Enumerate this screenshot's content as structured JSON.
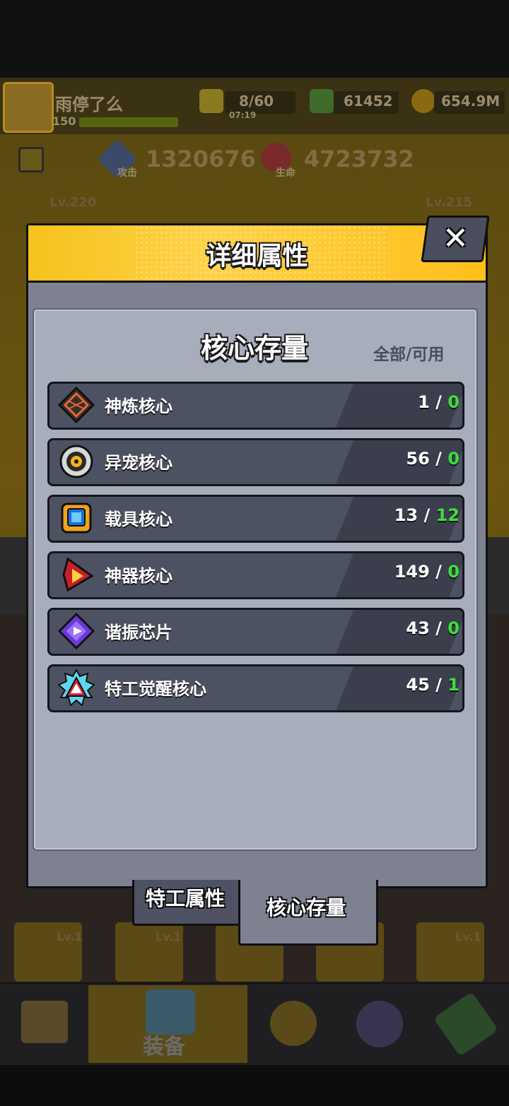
{
  "hud": {
    "player_name": "雨停了么",
    "player_level": "150",
    "energy": "8/60",
    "energy_timer": "07:19",
    "gems": "61452",
    "gold": "654.9M",
    "attack_label": "攻击",
    "attack_value": "1320676",
    "hp_label": "生命",
    "hp_value": "4723732",
    "left_level": "Lv.220",
    "right_level": "Lv.215"
  },
  "modal": {
    "title": "详细属性",
    "close_glyph": "✕",
    "panel_title": "核心存量",
    "panel_subtitle": "全部/可用",
    "rows": [
      {
        "label": "神炼核心",
        "total": "1",
        "sep": " / ",
        "available": "0",
        "icon": "forge-core-icon"
      },
      {
        "label": "异宠核心",
        "total": "56",
        "sep": " / ",
        "available": "0",
        "icon": "pet-core-icon"
      },
      {
        "label": "载具核心",
        "total": "13",
        "sep": " / ",
        "available": "12",
        "icon": "vehicle-core-icon"
      },
      {
        "label": "神器核心",
        "total": "149",
        "sep": " / ",
        "available": "0",
        "icon": "artifact-core-icon"
      },
      {
        "label": "谐振芯片",
        "total": "43",
        "sep": " / ",
        "available": "0",
        "icon": "resonance-chip-icon"
      },
      {
        "label": "特工觉醒核心",
        "total": "45",
        "sep": " / ",
        "available": "1",
        "icon": "agent-awaken-core-icon"
      }
    ]
  },
  "tabs": {
    "agent_attributes": "特工属性",
    "core_stock": "核心存量"
  },
  "bottom": {
    "card_level": "Lv.1",
    "nav_equipment": "装备"
  },
  "colors": {
    "header_yellow": "#f6c21b",
    "available_green": "#3dde3d",
    "modal_gray": "#7e8290",
    "row_gray": "#4d5263"
  }
}
